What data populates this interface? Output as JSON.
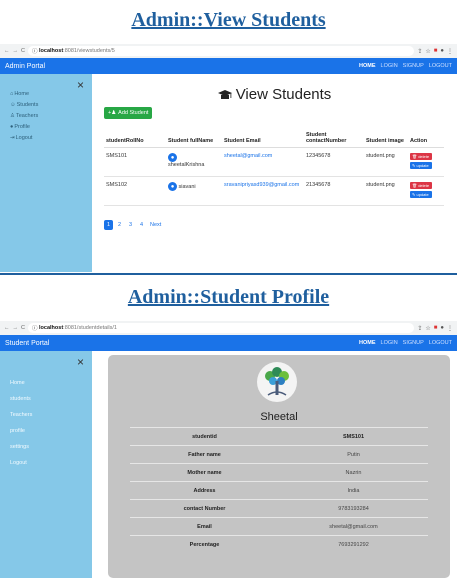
{
  "headings": {
    "view": "Admin::View Students",
    "profile": "Admin::Student Profile"
  },
  "browser1": {
    "url_host": "localhost",
    "url_path": ":8081/viewstudents/5"
  },
  "browser2": {
    "url_host": "localhost",
    "url_path": ":8081/studentdetails/1"
  },
  "app1": {
    "brand": "Admin Portal",
    "nav": [
      "HOME",
      "LOGIN",
      "SIGNUP",
      "LOGOUT"
    ],
    "sidebar_close": "×",
    "sidebar": [
      "Home",
      "Students",
      "Teachers",
      "Profile",
      "Logout"
    ],
    "title": "View Students",
    "add_button": "Add Student",
    "table": {
      "headers": [
        "studentRollNo",
        "Student fullName",
        "Student Email",
        "Student contactNumber",
        "Student image",
        "Action"
      ],
      "rows": [
        {
          "roll": "SMS101",
          "name": "sheetalKrishna",
          "email": "sheetal@gmail.com",
          "contact": "12345678",
          "image": "student.png"
        },
        {
          "roll": "SMS102",
          "name": "siavani",
          "email": "sravanipriyasd939@gmail.com",
          "contact": "21345678",
          "image": "student.png"
        }
      ],
      "delete_label": "delete",
      "update_label": "update"
    },
    "pagination": [
      "1",
      "2",
      "3",
      "4",
      "Next"
    ]
  },
  "app2": {
    "brand": "Student Portal",
    "nav": [
      "HOME",
      "LOGIN",
      "SIGNUP",
      "LOGOUT"
    ],
    "sidebar_close": "×",
    "sidebar": [
      "Home",
      "students",
      "Teachers",
      "profile",
      "settings",
      "Logout"
    ],
    "name": "Sheetal",
    "fields": [
      {
        "label": "studentid",
        "value": "SMS101"
      },
      {
        "label": "Father name",
        "value": "Putin"
      },
      {
        "label": "Mother name",
        "value": "Nazrin"
      },
      {
        "label": "Address",
        "value": "India"
      },
      {
        "label": "contact Number",
        "value": "9783193284"
      },
      {
        "label": "Email",
        "value": "sheetal@gmail.com"
      },
      {
        "label": "Percentage",
        "value": "7693291292"
      }
    ]
  },
  "colors": {
    "navbar": "#1a73e8",
    "sidebar": "#85c8e8",
    "heading": "#1f5f9e",
    "card": "#c4c4c4"
  }
}
